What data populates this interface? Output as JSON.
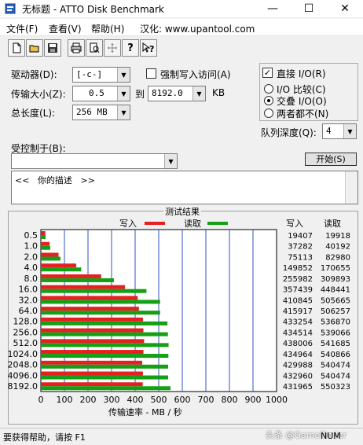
{
  "window": {
    "title": "无标题 - ATTO Disk Benchmark",
    "minimize": "—",
    "maximize": "☐",
    "close": "✕"
  },
  "menu": {
    "file": "文件(F)",
    "view": "查看(V)",
    "help": "帮助(H)",
    "localized": "汉化: www.upantool.com"
  },
  "toolbar": {
    "icons": [
      "new-document-icon",
      "open-folder-icon",
      "save-disk-icon",
      "print-icon",
      "print-preview-icon",
      "move-icon",
      "help-icon",
      "context-help-icon"
    ]
  },
  "settings": {
    "drive_label": "驱动器(D):",
    "drive_value": "[-c-]",
    "force_write_label": "强制写入访问(A)",
    "transfer_label": "传输大小(Z):",
    "transfer_from": "0.5",
    "to_label": "到",
    "transfer_to": "8192.0",
    "kb_label": "KB",
    "length_label": "总长度(L):",
    "length_value": "256 MB",
    "direct_io_label": "直接 I/O(R)",
    "io_compare_label": "I/O 比较(C)",
    "overlapped_io_label": "交叠 I/O(O)",
    "neither_label": "两者都不(N)",
    "queue_depth_label": "队列深度(Q):",
    "queue_depth_value": "4",
    "controlled_by_label": "受控制于(B):",
    "controlled_by_value": "",
    "start_label": "开始(S)",
    "description": "<<   你的描述   >>"
  },
  "results": {
    "title": "测试结果",
    "write_legend": "写入",
    "read_legend": "读取",
    "col_write": "写入",
    "col_read": "读取",
    "xlabel": "传输速率 - MB / 秒",
    "colors": {
      "write": "#e52020",
      "read": "#14a014"
    }
  },
  "chart_data": {
    "type": "bar",
    "orientation": "horizontal",
    "title": "测试结果",
    "xlabel": "传输速率 - MB / 秒",
    "xlim": [
      0,
      1000
    ],
    "xticks": [
      "0",
      "100",
      "200",
      "300",
      "400",
      "500",
      "600",
      "700",
      "800",
      "900",
      "1000"
    ],
    "grid": true,
    "legend": "top",
    "categories": [
      "0.5",
      "1.0",
      "2.0",
      "4.0",
      "8.0",
      "16.0",
      "32.0",
      "64.0",
      "128.0",
      "256.0",
      "512.0",
      "1024.0",
      "2048.0",
      "4096.0",
      "8192.0"
    ],
    "series": [
      {
        "name": "写入",
        "color": "#e52020",
        "values": [
          19,
          37,
          75,
          150,
          256,
          357,
          411,
          416,
          433,
          435,
          438,
          435,
          430,
          433,
          432
        ],
        "labels": [
          "19407",
          "37282",
          "75113",
          "149852",
          "255982",
          "357439",
          "410845",
          "415917",
          "433254",
          "434514",
          "438006",
          "434964",
          "429988",
          "432960",
          "431965"
        ]
      },
      {
        "name": "读取",
        "color": "#14a014",
        "values": [
          20,
          40,
          83,
          171,
          310,
          448,
          506,
          506,
          537,
          539,
          542,
          541,
          540,
          540,
          550
        ],
        "labels": [
          "19918",
          "40192",
          "82980",
          "170655",
          "309893",
          "448441",
          "505665",
          "506257",
          "536870",
          "539066",
          "541685",
          "540866",
          "540474",
          "540474",
          "550323"
        ]
      }
    ]
  },
  "status": {
    "text": "要获得帮助，请按 F1",
    "num": "NUM",
    "watermark": "头条 @GameFinder"
  }
}
